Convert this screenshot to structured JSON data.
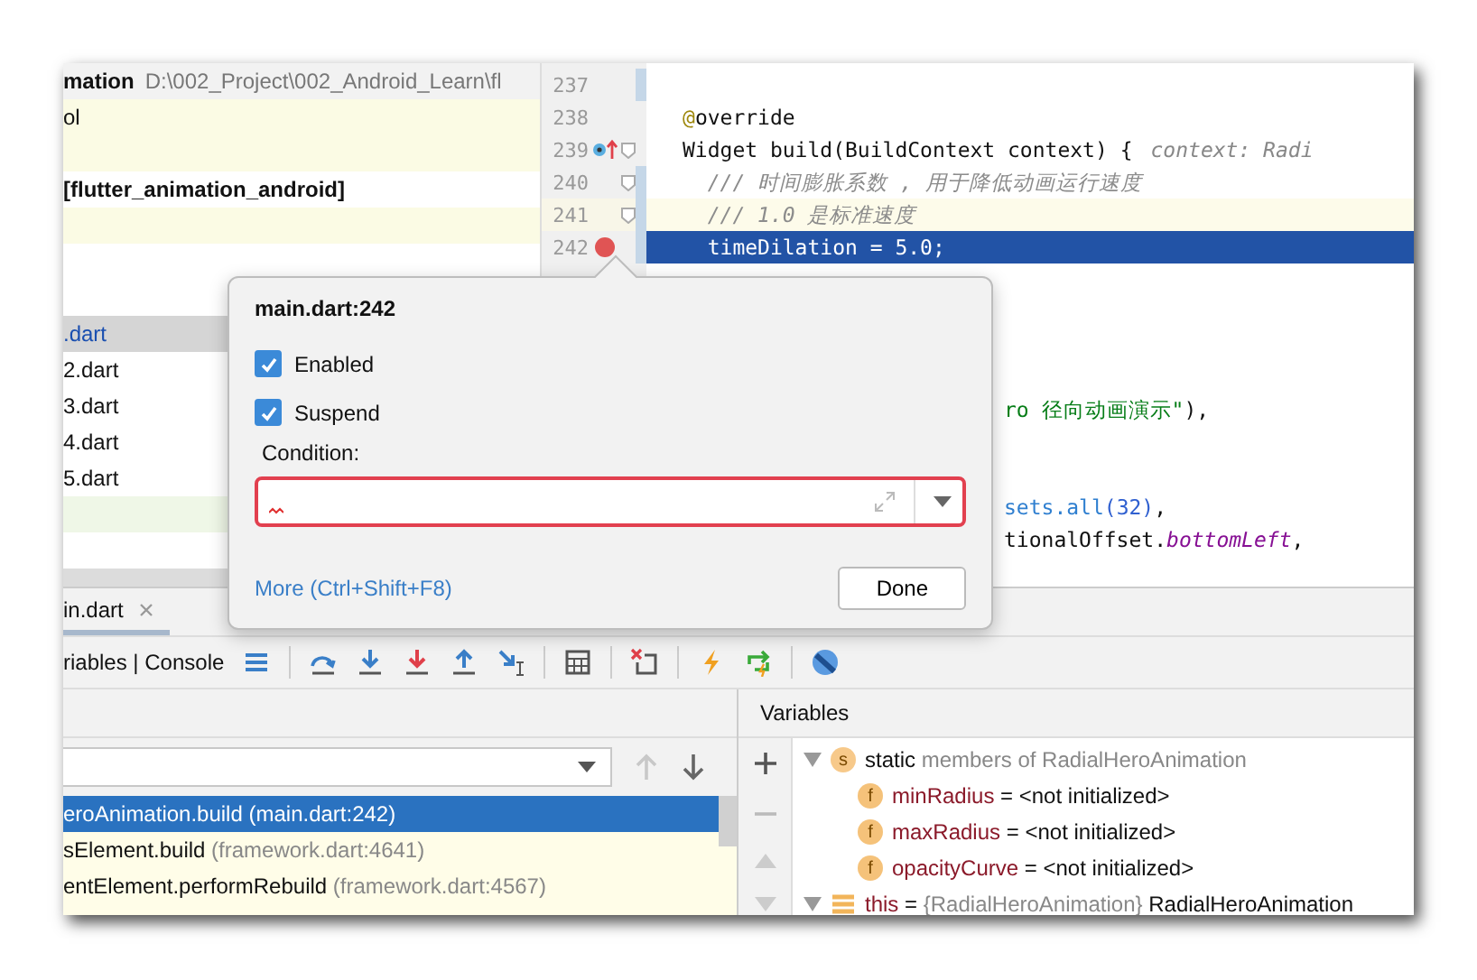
{
  "project_panel": {
    "rows": [
      {
        "kind": "header",
        "name": "mation",
        "path": "D:\\002_Project\\002_Android_Learn\\fl",
        "color": "#f2f2f2"
      },
      {
        "kind": "plain",
        "text": "ol",
        "color": "#fbfbe4"
      },
      {
        "kind": "empty",
        "color": "#fbfbe4"
      },
      {
        "kind": "bold",
        "text": "[flutter_animation_android]",
        "color": "#ffffff"
      },
      {
        "kind": "empty",
        "color": "#fbfbe4"
      },
      {
        "kind": "empty",
        "color": "#ffffff"
      },
      {
        "kind": "empty",
        "color": "#ffffff"
      },
      {
        "kind": "file",
        "text": ".dart",
        "color": "#d5d5d5",
        "selected": true
      },
      {
        "kind": "file",
        "text": "2.dart",
        "color": "#ffffff",
        "selected": false
      },
      {
        "kind": "file",
        "text": "3.dart",
        "color": "#ffffff",
        "selected": false
      },
      {
        "kind": "file",
        "text": "4.dart",
        "color": "#ffffff",
        "selected": false
      },
      {
        "kind": "file",
        "text": "5.dart",
        "color": "#ffffff",
        "selected": false
      },
      {
        "kind": "empty",
        "color": "#eff7e7"
      }
    ]
  },
  "editor": {
    "lines": [
      {
        "number": "237",
        "kind": "plain",
        "changed": true,
        "current": false,
        "selected": false,
        "fold": false
      },
      {
        "number": "238",
        "kind": "plain",
        "changed": false,
        "current": false,
        "selected": false,
        "fold": false,
        "segments": [
          {
            "text": "@",
            "kind": "annotation"
          },
          {
            "text": "override",
            "kind": "plain"
          }
        ]
      },
      {
        "number": "239",
        "kind": "override",
        "changed": false,
        "current": false,
        "selected": false,
        "fold": true,
        "segments": [
          {
            "text": "Widget build(BuildContext context) {",
            "kind": "plain"
          },
          {
            "text": "context: Radi",
            "kind": "hint"
          }
        ]
      },
      {
        "number": "240",
        "kind": "plain",
        "changed": true,
        "current": false,
        "selected": false,
        "fold": true,
        "segments": [
          {
            "text": "  /// 时间膨胀系数 , 用于降低动画运行速度",
            "kind": "comment"
          }
        ]
      },
      {
        "number": "241",
        "kind": "plain",
        "changed": true,
        "current": true,
        "selected": false,
        "fold": true,
        "segments": [
          {
            "text": "  /// 1.0 是标准速度",
            "kind": "comment"
          }
        ]
      },
      {
        "number": "242",
        "kind": "breakpoint",
        "changed": true,
        "current": false,
        "selected": true,
        "fold": false,
        "segments": [
          {
            "text": "  timeDilation = 5.0;",
            "kind": "plain"
          }
        ]
      }
    ],
    "fragments": [
      {
        "kind": "gap"
      },
      {
        "kind": "gap"
      },
      {
        "kind": "gap"
      },
      {
        "kind": "gap"
      },
      {
        "kind": "text",
        "segments": [
          {
            "text": "ro 径向动画演示\"",
            "kind": "string"
          },
          {
            "text": "),",
            "kind": "plain"
          }
        ]
      },
      {
        "kind": "gap"
      },
      {
        "kind": "gap"
      },
      {
        "kind": "text",
        "segments": [
          {
            "text": "sets.all",
            "kind": "method"
          },
          {
            "text": "(32)",
            "kind": "number"
          },
          {
            "text": ",",
            "kind": "plain"
          }
        ]
      },
      {
        "kind": "text",
        "segments": [
          {
            "text": "tionalOffset.",
            "kind": "plain"
          },
          {
            "text": "bottomLeft",
            "kind": "field"
          },
          {
            "text": ",",
            "kind": "plain"
          }
        ]
      }
    ]
  },
  "breakpoint_popup": {
    "title": "main.dart:242",
    "checkboxes": [
      {
        "label": "Enabled",
        "checked": true
      },
      {
        "label": "Suspend",
        "checked": true
      }
    ],
    "condition_label": "Condition:",
    "condition_error": true,
    "more_link": "More (Ctrl+Shift+F8)",
    "done_button": "Done"
  },
  "debug_panel": {
    "tabs": [
      {
        "label": "in.dart",
        "selected": true
      }
    ],
    "view_tabs": "riables | Console",
    "variables_title": "Variables",
    "frames": [
      {
        "method": "eroAnimation.build",
        "location": "(main.dart:242)",
        "selected": true
      },
      {
        "method": "sElement.build",
        "location": "(framework.dart:4641)",
        "selected": false
      },
      {
        "method": "entElement.performRebuild",
        "location": "(framework.dart:4567)",
        "selected": false
      }
    ],
    "variables": [
      {
        "kind": "static",
        "badge": "s",
        "name": "static",
        "value": "members of RadialHeroAnimation",
        "expanded": true,
        "children": [
          {
            "kind": "field",
            "badge": "f",
            "name": "minRadius",
            "value": "= <not initialized>"
          },
          {
            "kind": "field",
            "badge": "f",
            "name": "maxRadius",
            "value": "= <not initialized>"
          },
          {
            "kind": "field",
            "badge": "f",
            "name": "opacityCurve",
            "value": "= <not initialized>"
          }
        ]
      },
      {
        "kind": "object",
        "name": "this",
        "type": "= {RadialHeroAnimation}",
        "value": "RadialHeroAnimation",
        "expanded": true
      }
    ]
  }
}
